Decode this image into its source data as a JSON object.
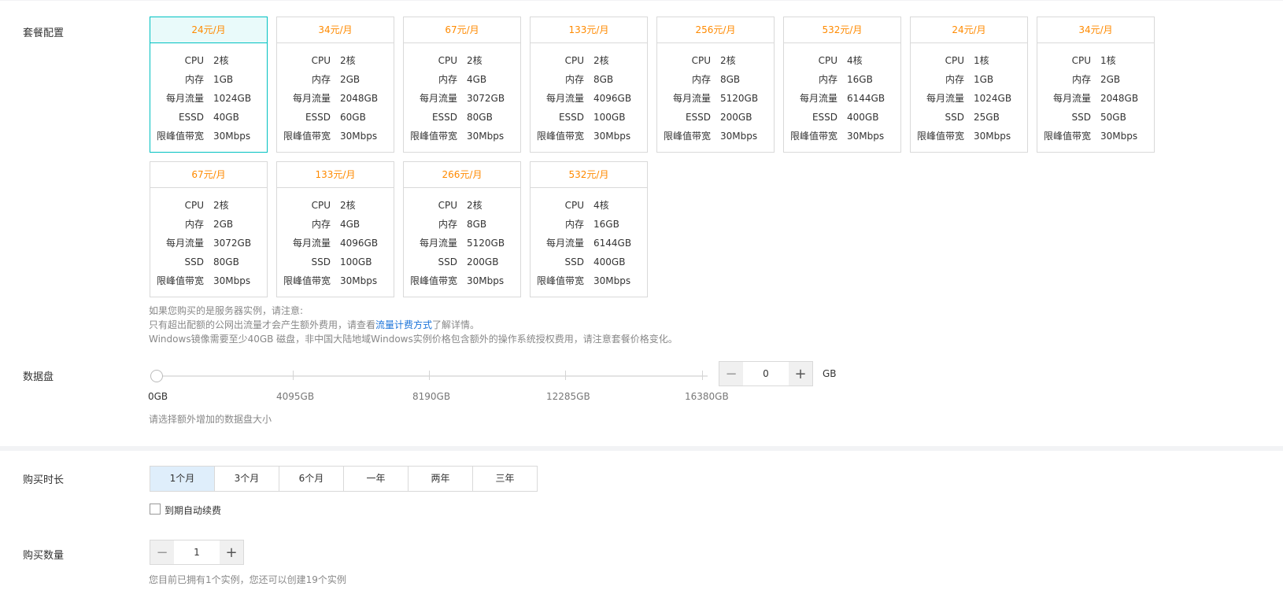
{
  "package_config": {
    "label": "套餐配置",
    "packages": [
      {
        "price": "24元/月",
        "specs": [
          [
            "CPU",
            "2核"
          ],
          [
            "内存",
            "1GB"
          ],
          [
            "每月流量",
            "1024GB"
          ],
          [
            "ESSD",
            "40GB"
          ],
          [
            "限峰值带宽",
            "30Mbps"
          ]
        ],
        "selected": true
      },
      {
        "price": "34元/月",
        "specs": [
          [
            "CPU",
            "2核"
          ],
          [
            "内存",
            "2GB"
          ],
          [
            "每月流量",
            "2048GB"
          ],
          [
            "ESSD",
            "60GB"
          ],
          [
            "限峰值带宽",
            "30Mbps"
          ]
        ]
      },
      {
        "price": "67元/月",
        "specs": [
          [
            "CPU",
            "2核"
          ],
          [
            "内存",
            "4GB"
          ],
          [
            "每月流量",
            "3072GB"
          ],
          [
            "ESSD",
            "80GB"
          ],
          [
            "限峰值带宽",
            "30Mbps"
          ]
        ]
      },
      {
        "price": "133元/月",
        "specs": [
          [
            "CPU",
            "2核"
          ],
          [
            "内存",
            "8GB"
          ],
          [
            "每月流量",
            "4096GB"
          ],
          [
            "ESSD",
            "100GB"
          ],
          [
            "限峰值带宽",
            "30Mbps"
          ]
        ]
      },
      {
        "price": "256元/月",
        "specs": [
          [
            "CPU",
            "2核"
          ],
          [
            "内存",
            "8GB"
          ],
          [
            "每月流量",
            "5120GB"
          ],
          [
            "ESSD",
            "200GB"
          ],
          [
            "限峰值带宽",
            "30Mbps"
          ]
        ]
      },
      {
        "price": "532元/月",
        "specs": [
          [
            "CPU",
            "4核"
          ],
          [
            "内存",
            "16GB"
          ],
          [
            "每月流量",
            "6144GB"
          ],
          [
            "ESSD",
            "400GB"
          ],
          [
            "限峰值带宽",
            "30Mbps"
          ]
        ]
      },
      {
        "price": "24元/月",
        "specs": [
          [
            "CPU",
            "1核"
          ],
          [
            "内存",
            "1GB"
          ],
          [
            "每月流量",
            "1024GB"
          ],
          [
            "SSD",
            "25GB"
          ],
          [
            "限峰值带宽",
            "30Mbps"
          ]
        ]
      },
      {
        "price": "34元/月",
        "specs": [
          [
            "CPU",
            "1核"
          ],
          [
            "内存",
            "2GB"
          ],
          [
            "每月流量",
            "2048GB"
          ],
          [
            "SSD",
            "50GB"
          ],
          [
            "限峰值带宽",
            "30Mbps"
          ]
        ]
      },
      {
        "price": "67元/月",
        "specs": [
          [
            "CPU",
            "2核"
          ],
          [
            "内存",
            "2GB"
          ],
          [
            "每月流量",
            "3072GB"
          ],
          [
            "SSD",
            "80GB"
          ],
          [
            "限峰值带宽",
            "30Mbps"
          ]
        ]
      },
      {
        "price": "133元/月",
        "specs": [
          [
            "CPU",
            "2核"
          ],
          [
            "内存",
            "4GB"
          ],
          [
            "每月流量",
            "4096GB"
          ],
          [
            "SSD",
            "100GB"
          ],
          [
            "限峰值带宽",
            "30Mbps"
          ]
        ]
      },
      {
        "price": "266元/月",
        "specs": [
          [
            "CPU",
            "2核"
          ],
          [
            "内存",
            "8GB"
          ],
          [
            "每月流量",
            "5120GB"
          ],
          [
            "SSD",
            "200GB"
          ],
          [
            "限峰值带宽",
            "30Mbps"
          ]
        ]
      },
      {
        "price": "532元/月",
        "specs": [
          [
            "CPU",
            "4核"
          ],
          [
            "内存",
            "16GB"
          ],
          [
            "每月流量",
            "6144GB"
          ],
          [
            "SSD",
            "400GB"
          ],
          [
            "限峰值带宽",
            "30Mbps"
          ]
        ]
      }
    ],
    "notes": {
      "line1": "如果您购买的是服务器实例，请注意:",
      "line2_pre": "只有超出配额的公网出流量才会产生额外费用，请查看",
      "line2_link": "流量计费方式",
      "line2_post": "了解详情。",
      "line3": "Windows镜像需要至少40GB 磁盘，非中国大陆地域Windows实例价格包含额外的操作系统授权费用，请注意套餐价格变化。"
    },
    "accent_color": "#00c1c1",
    "price_color": "#ff8a00"
  },
  "data_disk": {
    "label": "数据盘",
    "slider_marks": [
      "0GB",
      "4095GB",
      "8190GB",
      "12285GB",
      "16380GB"
    ],
    "slider_value_gb": 0,
    "value": "0",
    "unit": "GB",
    "hint": "请选择额外增加的数据盘大小"
  },
  "duration": {
    "label": "购买时长",
    "options": [
      "1个月",
      "3个月",
      "6个月",
      "一年",
      "两年",
      "三年"
    ],
    "selected": "1个月",
    "auto_renew_label": "到期自动续费",
    "auto_renew_checked": false
  },
  "quantity": {
    "label": "购买数量",
    "value": "1",
    "hint": "您目前已拥有1个实例，您还可以创建19个实例"
  },
  "icons": {
    "minus": "−",
    "plus": "+"
  }
}
